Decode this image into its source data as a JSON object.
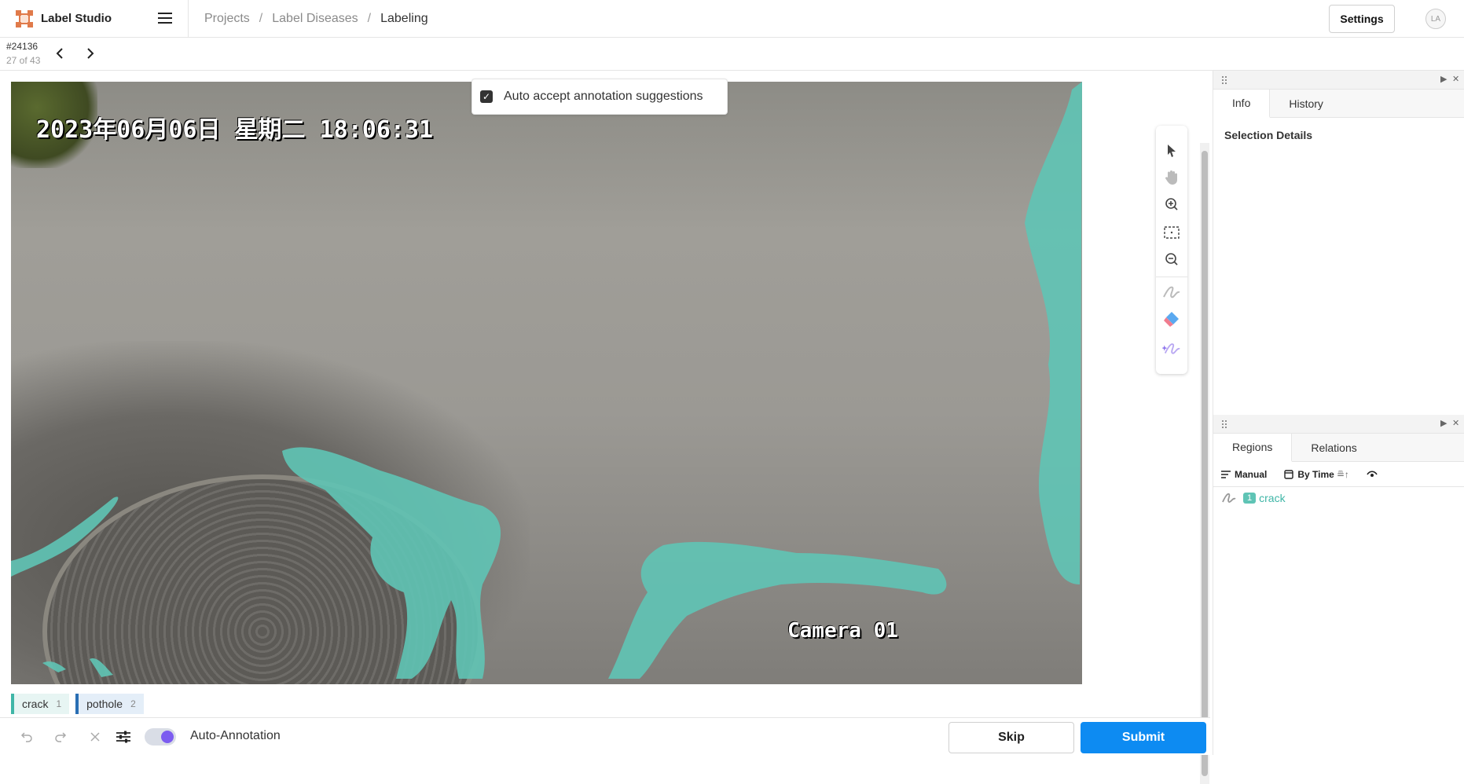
{
  "app": {
    "title": "Label Studio"
  },
  "breadcrumb": [
    "Projects",
    "Label Diseases",
    "Labeling"
  ],
  "header": {
    "settings_label": "Settings",
    "avatar_initials": "LA"
  },
  "task": {
    "id": "#24136",
    "position": "27 of 43"
  },
  "canvas": {
    "auto_accept_label": "Auto accept annotation suggestions",
    "auto_accept_checked": true,
    "image_overlay_datetime": "2023年06月06日 星期二 18:06:31",
    "image_overlay_camera": "Camera 01",
    "tools": [
      "pointer-icon",
      "pan-hand-icon",
      "zoom-in-icon",
      "fit-icon",
      "zoom-out-icon",
      "brush-icon",
      "eraser-icon",
      "magic-brush-icon"
    ]
  },
  "labels": [
    {
      "name": "crack",
      "hotkey": "1",
      "color": "#3fb6a7"
    },
    {
      "name": "pothole",
      "hotkey": "2",
      "color": "#2a6fb4"
    }
  ],
  "bottom": {
    "auto_annotation_label": "Auto-Annotation",
    "auto_annotation_on": true,
    "skip_label": "Skip",
    "submit_label": "Submit"
  },
  "side_panel": {
    "top_tabs": [
      "Info",
      "History"
    ],
    "selection_details": "Selection Details",
    "bottom_tabs": [
      "Regions",
      "Relations"
    ],
    "regions_toolbar": {
      "group": "Manual",
      "sort": "By Time"
    },
    "regions": [
      {
        "index": "1",
        "label": "crack"
      }
    ]
  }
}
